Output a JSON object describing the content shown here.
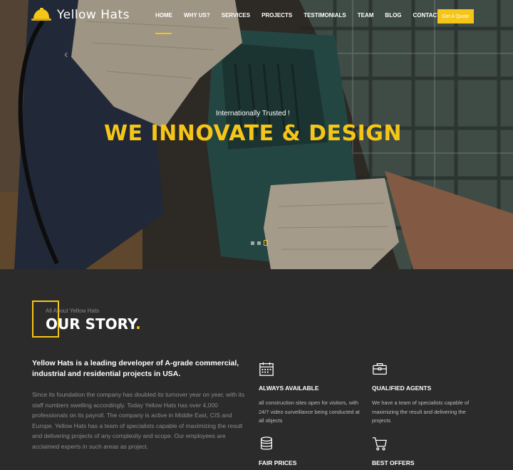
{
  "brand": {
    "name": "Yellow Hats",
    "accent": "#f5c518"
  },
  "nav": {
    "items": [
      {
        "label": "HOME",
        "active": true
      },
      {
        "label": "WHY US?"
      },
      {
        "label": "SERVICES"
      },
      {
        "label": "PROJECTS"
      },
      {
        "label": "TESTIMONIALS"
      },
      {
        "label": "TEAM"
      },
      {
        "label": "BLOG"
      },
      {
        "label": "CONTACT"
      }
    ],
    "cta": "Get A Quote"
  },
  "hero": {
    "eyebrow": "Internationally Trusted !",
    "title": "WE INNOVATE & DESIGN",
    "slides": 3,
    "active_slide": 3
  },
  "story": {
    "eyebrow": "All About Yellow Hats",
    "title": "OUR STORY",
    "title_dot": ".",
    "lead": "Yellow Hats is a leading developer of A-grade commercial, industrial and residential projects in USA.",
    "body": "Since its foundation the company has doubled its turnover year on year, with its staff numbers swelling accordingly. Today Yellow Hats has over 4,000 professionals on its payroll. The company is active in Middle East, CIS and Europe. Yellow Hats has a team of specialists capable of maximizing the result and delivering projects of any complexity and scope. Our employees are acclaimed experts in such areas as project."
  },
  "features": [
    {
      "icon": "calendar-icon",
      "title": "ALWAYS AVAILABLE",
      "desc": "all construction sites open for visitors, with 24/7 video surveillance being conducted at all objects"
    },
    {
      "icon": "briefcase-icon",
      "title": "QUALIFIED AGENTS",
      "desc": "We have a team of specialists capable of maximizing the result and delivering the projects"
    },
    {
      "icon": "coins-icon",
      "title": "FAIR PRICES",
      "desc": ""
    },
    {
      "icon": "cart-icon",
      "title": "BEST OFFERS",
      "desc": ""
    }
  ]
}
